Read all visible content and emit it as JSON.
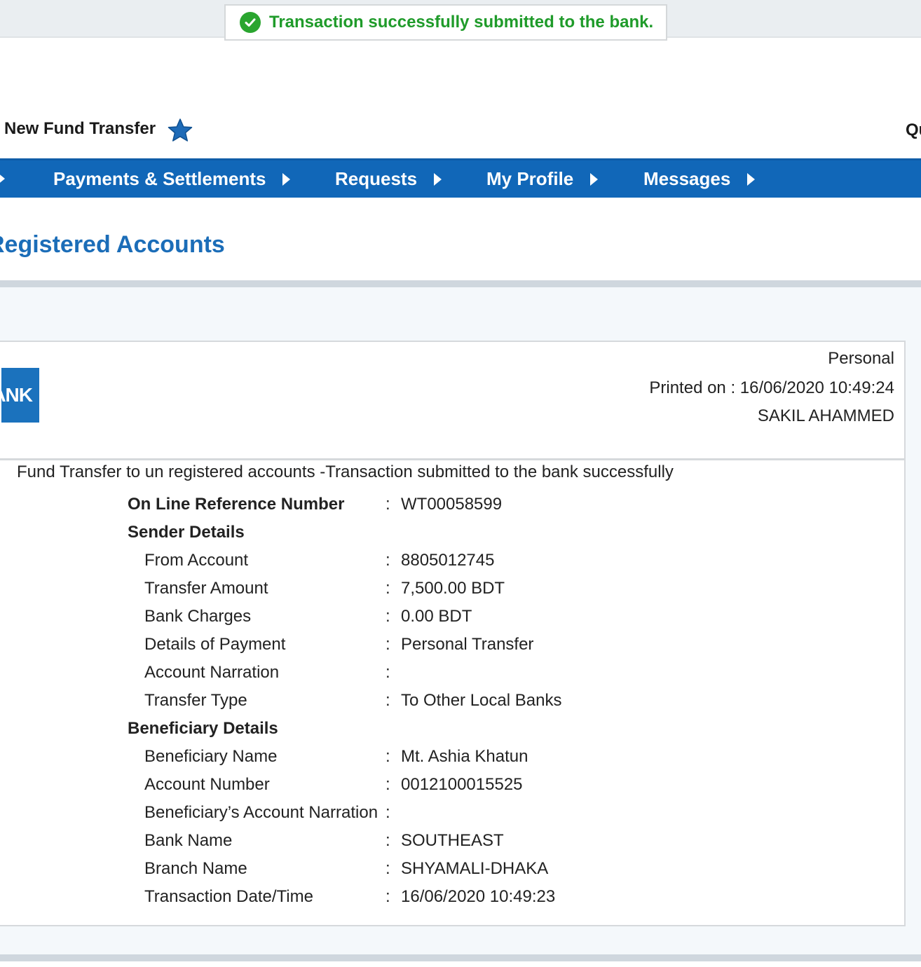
{
  "toast": {
    "message": "Transaction successfully submitted to the bank.",
    "icon": "check-circle-icon",
    "color": "#1f9b2a"
  },
  "header": {
    "page_title": "New Fund Transfer",
    "favorite_icon": "star-icon",
    "right_link_partial": "Qu"
  },
  "nav": {
    "items": [
      {
        "label": "Payments & Settlements"
      },
      {
        "label": "Requests"
      },
      {
        "label": "My Profile"
      },
      {
        "label": "Messages"
      }
    ]
  },
  "section_title": "Registered Accounts",
  "receipt": {
    "logo_text": "ANK",
    "account_type": "Personal",
    "printed_on": "Printed on : 16/06/2020 10:49:24",
    "customer_name": "SAKIL AHAMMED",
    "summary": "Fund Transfer to un registered accounts -Transaction submitted to the bank successfully",
    "reference_label": "On Line Reference Number",
    "reference_value": "WT00058599",
    "sender_heading": "Sender Details",
    "sender": [
      {
        "label": "From Account",
        "value": "8805012745"
      },
      {
        "label": "Transfer Amount",
        "value": "7,500.00 BDT"
      },
      {
        "label": "Bank Charges",
        "value": "0.00 BDT"
      },
      {
        "label": "Details of Payment",
        "value": "Personal Transfer"
      },
      {
        "label": "Account Narration",
        "value": ""
      },
      {
        "label": "Transfer Type",
        "value": "To Other Local Banks"
      }
    ],
    "beneficiary_heading": "Beneficiary Details",
    "beneficiary": [
      {
        "label": "Beneficiary Name",
        "value": "Mt. Ashia Khatun"
      },
      {
        "label": "Account Number",
        "value": "0012100015525"
      },
      {
        "label": "Beneficiary’s Account Narration",
        "value": ""
      },
      {
        "label": "Bank Name",
        "value": "SOUTHEAST"
      },
      {
        "label": "Branch Name",
        "value": "SHYAMALI-DHAKA"
      },
      {
        "label": "Transaction Date/Time",
        "value": "16/06/2020 10:49:23"
      }
    ],
    "separator": ":"
  },
  "colors": {
    "nav_bg": "#1167b8",
    "title_blue": "#1b6db8",
    "success_green": "#1f9b2a"
  }
}
